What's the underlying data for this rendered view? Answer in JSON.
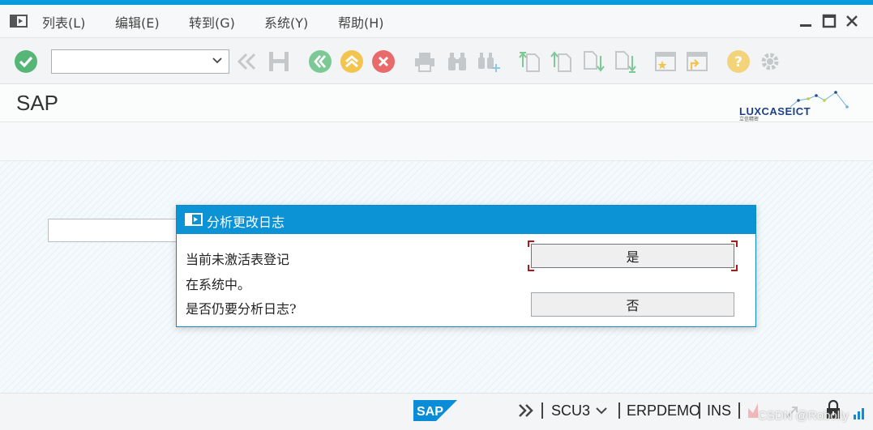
{
  "menubar": {
    "items": [
      "列表(L)",
      "编辑(E)",
      "转到(G)",
      "系统(Y)",
      "帮助(H)"
    ]
  },
  "toolbar": {
    "command_field_value": "",
    "icons": [
      "enter-check-icon",
      "double-left-arrows-icon",
      "save-icon",
      "back-icon",
      "exit-icon",
      "cancel-icon",
      "print-icon",
      "find-icon",
      "find-next-icon",
      "first-page-icon",
      "previous-page-icon",
      "next-page-icon",
      "last-page-icon",
      "create-session-icon",
      "shortcut-icon",
      "help-icon",
      "customize-layout-icon"
    ]
  },
  "header": {
    "title": "SAP",
    "logo_text": "LUXCASEICT",
    "logo_sub": "立信精密"
  },
  "dialog": {
    "title": "分析更改日志",
    "message_lines": [
      "当前未激活表登记",
      "在系统中。",
      "是否仍要分析日志?"
    ],
    "yes_label": "是",
    "no_label": "否"
  },
  "status": {
    "transaction": "SCU3",
    "system": "ERPDEMO",
    "mode": "INS",
    "sap_logo_text": "SAP",
    "watermark": "CSDN @Robolly"
  },
  "colors": {
    "accent": "#0c93d6",
    "green": "#56b677",
    "orange": "#f1b940",
    "red": "#e25b5b",
    "focus_corner": "#b01818"
  }
}
